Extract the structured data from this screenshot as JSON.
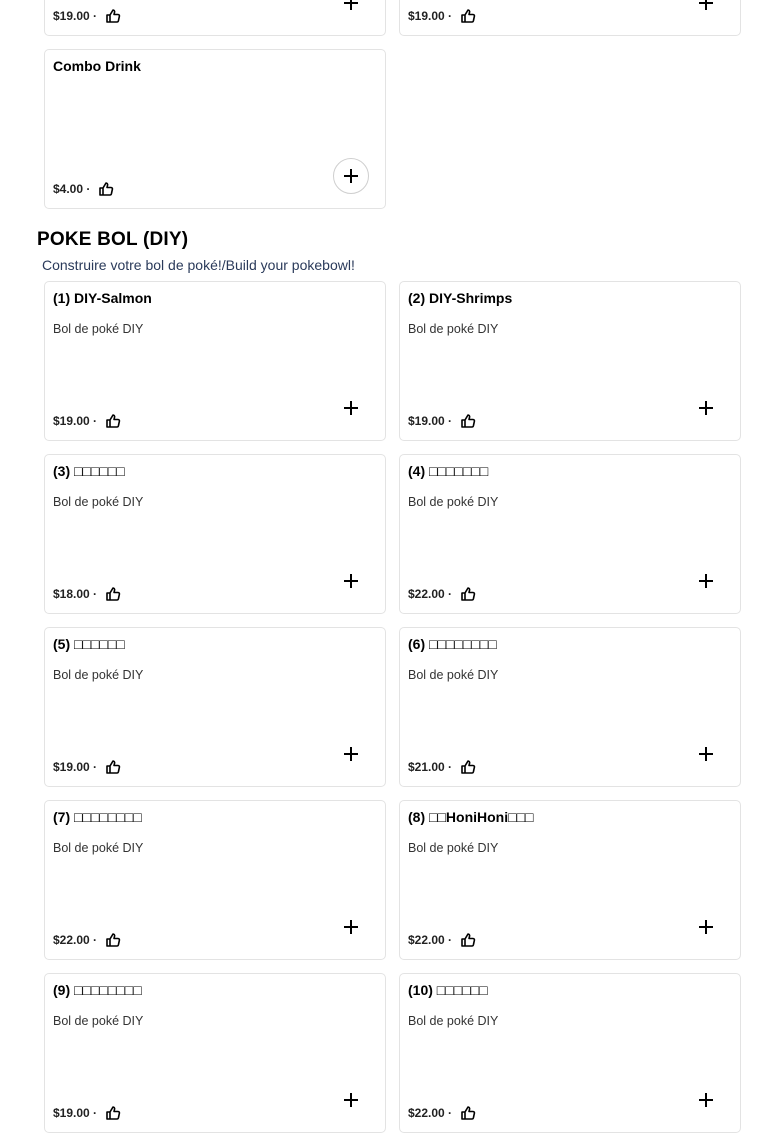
{
  "top_cards": [
    {
      "price": "$19.00",
      "sep": "·"
    },
    {
      "price": "$19.00",
      "sep": "·"
    }
  ],
  "combo": {
    "name": "Combo Drink",
    "price": "$4.00",
    "sep": "·"
  },
  "section": {
    "title": "POKE BOL (DIY)",
    "description": "Construire votre bol de poké!/Build your pokebowl!"
  },
  "items": [
    {
      "name": "(1) DIY-Salmon",
      "desc": "Bol de poké DIY",
      "price": "$19.00",
      "sep": "·"
    },
    {
      "name": "(2) DIY-Shrimps",
      "desc": "Bol de poké DIY",
      "price": "$19.00",
      "sep": "·"
    },
    {
      "name": "(3) □□□□□□",
      "desc": "Bol de poké DIY",
      "price": "$18.00",
      "sep": "·"
    },
    {
      "name": "(4) □□□□□□□",
      "desc": "Bol de poké DIY",
      "price": "$22.00",
      "sep": "·"
    },
    {
      "name": "(5) □□□□□□",
      "desc": "Bol de poké DIY",
      "price": "$19.00",
      "sep": "·"
    },
    {
      "name": "(6) □□□□□□□□",
      "desc": "Bol de poké DIY",
      "price": "$21.00",
      "sep": "·"
    },
    {
      "name": "(7) □□□□□□□□",
      "desc": "Bol de poké DIY",
      "price": "$22.00",
      "sep": "·"
    },
    {
      "name": "(8) □□HoniHoni□□□",
      "desc": "Bol de poké DIY",
      "price": "$22.00",
      "sep": "·"
    },
    {
      "name": "(9) □□□□□□□□",
      "desc": "Bol de poké DIY",
      "price": "$19.00",
      "sep": "·"
    },
    {
      "name": "(10) □□□□□□",
      "desc": "Bol de poké DIY",
      "price": "$22.00",
      "sep": "·"
    }
  ],
  "icons": {
    "like": "thumbs-up-icon",
    "add": "plus-icon"
  }
}
